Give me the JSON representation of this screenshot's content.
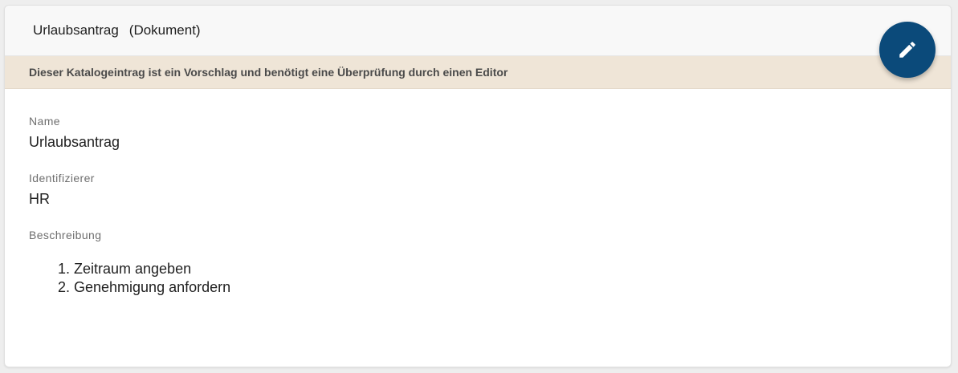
{
  "header": {
    "title": "Urlaubsantrag",
    "type": "(Dokument)"
  },
  "notice": {
    "text": "Dieser Katalogeintrag ist ein Vorschlag und benötigt eine Überprüfung durch einen Editor",
    "color": "#efe5d7"
  },
  "fields": {
    "name": {
      "label": "Name",
      "value": "Urlaubsantrag"
    },
    "identifier": {
      "label": "Identifizierer",
      "value": "HR"
    },
    "description": {
      "label": "Beschreibung",
      "items": [
        "Zeitraum angeben",
        "Genehmigung anfordern"
      ]
    }
  },
  "fab": {
    "icon": "pencil-icon",
    "color": "#0b4a7a"
  }
}
